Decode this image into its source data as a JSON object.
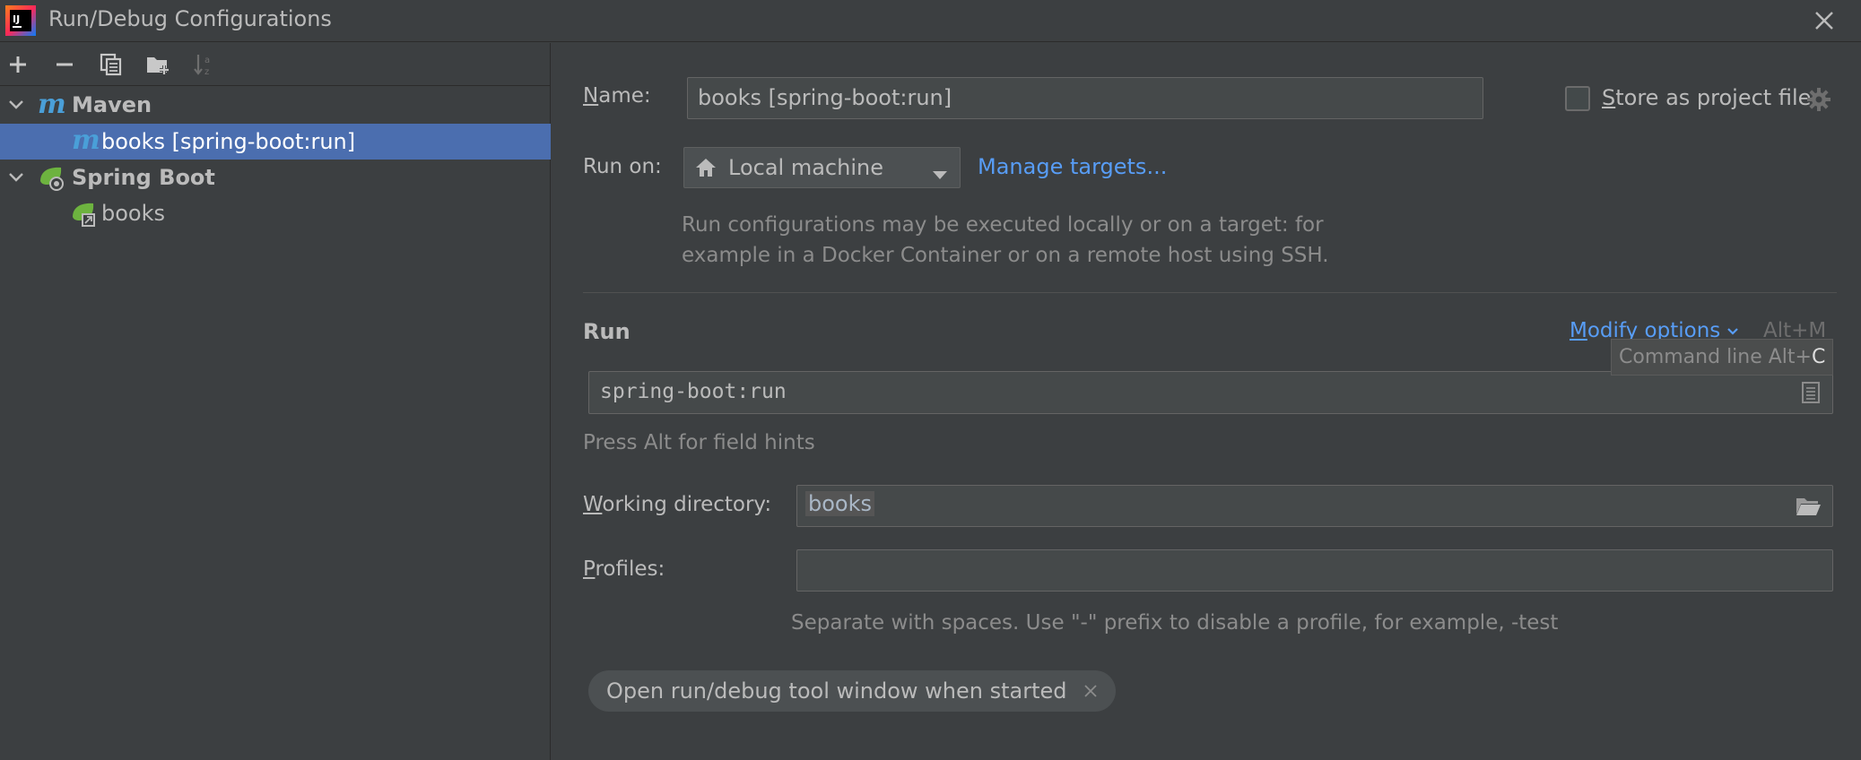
{
  "window": {
    "title": "Run/Debug Configurations"
  },
  "toolbar": {
    "icons": [
      "add-icon",
      "remove-icon",
      "copy-icon",
      "new-folder-icon",
      "sort-icon"
    ]
  },
  "tree": {
    "maven_label": "Maven",
    "maven_item": "books [spring-boot:run]",
    "springboot_label": "Spring Boot",
    "springboot_item": "books"
  },
  "form": {
    "name_label_first": "N",
    "name_label_rest": "ame:",
    "name_value": "books [spring-boot:run]",
    "store_label_first": "S",
    "store_label_rest": "tore as project file",
    "store_checked": false,
    "run_on_label": "Run on:",
    "run_on_value": "Local machine",
    "manage_targets": "Manage targets...",
    "run_on_hint_line1": "Run configurations may be executed locally or on a target: for",
    "run_on_hint_line2": "example in a Docker Container or on a remote host using SSH.",
    "run_section": "Run",
    "modify_first": "M",
    "modify_rest": "odify options",
    "modify_shortcut": "Alt+M",
    "tooltip_text": "Command line Alt+",
    "tooltip_key": "C",
    "command_value": "spring-boot:run",
    "alt_hint": "Press Alt for field hints",
    "workdir_label_first": "W",
    "workdir_label_rest": "orking directory:",
    "workdir_value": "books",
    "profiles_label_first": "P",
    "profiles_label_rest": "rofiles:",
    "profiles_value": "",
    "profiles_hint": "Separate with spaces. Use \"-\" prefix to disable a profile, for example, -test",
    "chip_label": "Open run/debug tool window when started"
  },
  "colors": {
    "background": "#3c3f41",
    "selection": "#4b6eaf",
    "link": "#589df6",
    "maven": "#4a9fd8",
    "spring": "#6db33f"
  }
}
